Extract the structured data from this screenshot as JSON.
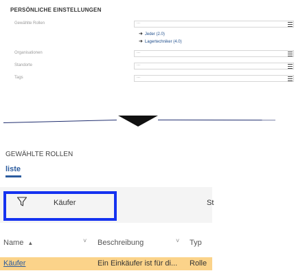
{
  "settings": {
    "title": "PERSÖNLICHE EINSTELLUNGEN",
    "rows": [
      {
        "label": "Gewählte Rollen",
        "value": "..."
      },
      {
        "label": "Organisationen",
        "value": "..."
      },
      {
        "label": "Standorte",
        "value": "..."
      },
      {
        "label": "Tags",
        "value": "..."
      }
    ],
    "roles": [
      {
        "name": "Jeder (2.0)"
      },
      {
        "name": "Lagertechniker (4.0)"
      }
    ]
  },
  "panel": {
    "title": "GEWÄHLTE ROLLEN",
    "tab": "liste",
    "filter_value": "Käufer",
    "cut_off_text": "St",
    "columns": [
      {
        "label": "Name",
        "sort": "▲",
        "chev": "˅"
      },
      {
        "label": "Beschreibung",
        "chev": "˅"
      },
      {
        "label": "Typ"
      }
    ],
    "rows": [
      {
        "name": "Käufer",
        "description": "Ein Einkäufer ist für di...",
        "type": "Rolle"
      }
    ]
  },
  "colors": {
    "accent": "#2b5b9e",
    "highlight_border": "#1432f0",
    "selected_row": "#fbd38a"
  }
}
